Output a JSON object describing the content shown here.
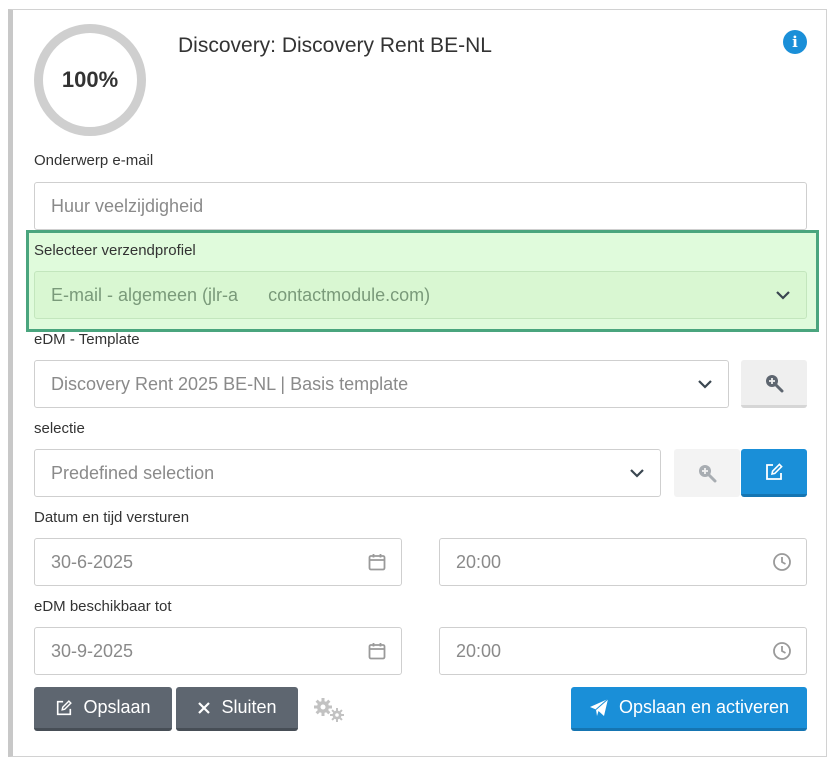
{
  "header": {
    "progress": "100%",
    "title": "Discovery: Discovery Rent BE-NL"
  },
  "subject": {
    "label": "Onderwerp e-mail",
    "placeholder": "Huur veelzijdigheid"
  },
  "profile": {
    "label": "Selecteer verzendprofiel",
    "value_start": "E-mail - algemeen (jlr-a",
    "value_end": "contactmodule.com)"
  },
  "template": {
    "label": "eDM - Template",
    "value": "Discovery Rent 2025 BE-NL | Basis template"
  },
  "selection": {
    "label": "selectie",
    "value": "Predefined selection"
  },
  "send": {
    "label": "Datum en tijd versturen",
    "date": "30-6-2025",
    "time": "20:00"
  },
  "available": {
    "label": "eDM beschikbaar tot",
    "date": "30-9-2025",
    "time": "20:00"
  },
  "actions": {
    "save": "Opslaan",
    "close": "Sluiten",
    "save_activate": "Opslaan en activeren"
  },
  "colors": {
    "accent": "#1a8fd8",
    "highlight_border": "#4aa57e",
    "highlight_bg": "#e0fbdc",
    "dark_button": "#5e6670"
  },
  "icons": [
    "info-icon",
    "chevron-down-icon",
    "zoom-in-icon",
    "edit-icon",
    "calendar-icon",
    "clock-icon",
    "close-icon",
    "gears-icon",
    "paper-plane-icon"
  ]
}
